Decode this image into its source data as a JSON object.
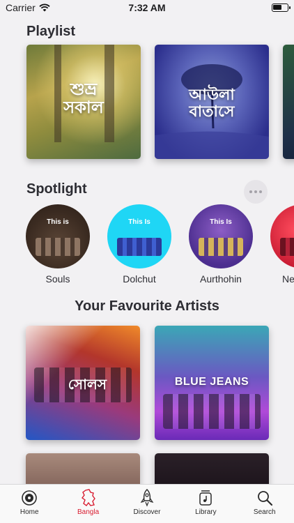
{
  "status": {
    "carrier": "Carrier",
    "time": "7:32 AM"
  },
  "sections": {
    "playlist": "Playlist",
    "spotlight": "Spotlight",
    "artists": "Your Favourite Artists"
  },
  "playlists": [
    {
      "title": "শুভ্র সকাল"
    },
    {
      "title": "আউলা বাতাসে"
    }
  ],
  "spotlight": [
    {
      "prefix": "This is",
      "name": "Souls"
    },
    {
      "prefix": "This Is",
      "name": "Dolchut"
    },
    {
      "prefix": "This Is",
      "name": "Aurthohin"
    },
    {
      "prefix": "",
      "name": "Ne"
    }
  ],
  "artists": [
    {
      "title": "সোলস"
    },
    {
      "title": "BLUE JEANS"
    }
  ],
  "tabs": [
    {
      "label": "Home",
      "icon": "home-icon"
    },
    {
      "label": "Bangla",
      "icon": "bangladesh-map-icon"
    },
    {
      "label": "Discover",
      "icon": "rocket-icon"
    },
    {
      "label": "Library",
      "icon": "library-icon"
    },
    {
      "label": "Search",
      "icon": "search-icon"
    }
  ],
  "colors": {
    "accent": "#d81b2f",
    "background": "#f2f1f3"
  }
}
